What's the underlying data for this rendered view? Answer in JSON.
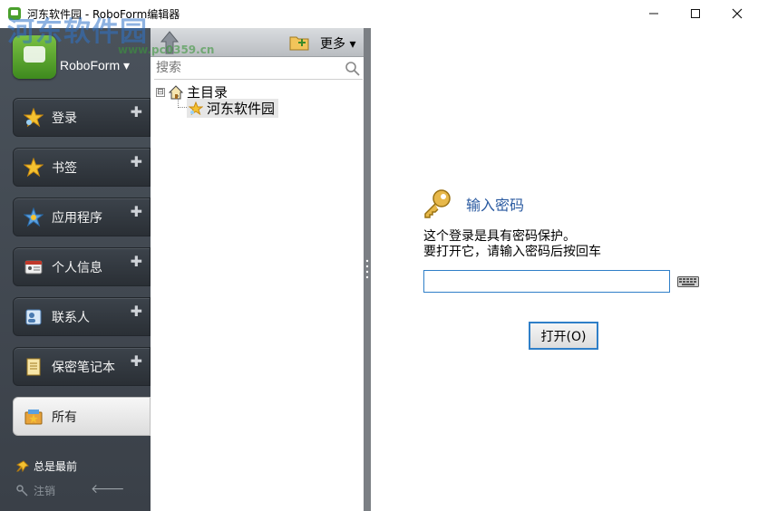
{
  "window": {
    "title": "河东软件园 - RoboForm编辑器",
    "minimize_icon": "minimize-icon",
    "maximize_icon": "maximize-icon",
    "close_icon": "close-icon"
  },
  "watermark": {
    "main": "河东软件园",
    "sub": "www.pc0359.cn"
  },
  "sidebar": {
    "brand": "RoboForm ▾",
    "items": [
      {
        "label": "登录",
        "icon": "login-star-icon",
        "plus": "✚"
      },
      {
        "label": "书签",
        "icon": "bookmark-star-icon",
        "plus": "✚"
      },
      {
        "label": "应用程序",
        "icon": "application-icon",
        "plus": "✚"
      },
      {
        "label": "个人信息",
        "icon": "identity-card-icon",
        "plus": "✚"
      },
      {
        "label": "联系人",
        "icon": "contact-card-icon",
        "plus": "✚"
      },
      {
        "label": "保密笔记本",
        "icon": "notepad-icon",
        "plus": "✚"
      },
      {
        "label": "所有",
        "icon": "all-items-icon",
        "plus": ""
      }
    ],
    "pin_label": "总是最前",
    "logout_label": "注销"
  },
  "middle": {
    "more_label": "更多 ▾",
    "search_placeholder": "搜索",
    "tree": {
      "toggle": "⊟",
      "root_label": "主目录",
      "child_label": "河东软件园"
    }
  },
  "main": {
    "title": "输入密码",
    "message_line1": "这个登录是具有密码保护。",
    "message_line2": "要打开它，请输入密码后按回车",
    "password_value": "",
    "open_button": "打开(O)"
  },
  "colors": {
    "accent": "#2f7fc8",
    "sidebar_bg": "#3f464e",
    "title_text": "#2a5aa0"
  }
}
